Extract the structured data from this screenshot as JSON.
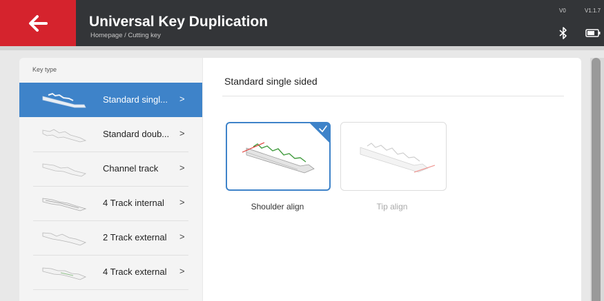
{
  "header": {
    "title": "Universal Key Duplication",
    "breadcrumb": "Homepage / Cutting key",
    "version_v0": "V0",
    "version_v1": "V1.1.7",
    "back_icon": "arrow-left-icon",
    "bluetooth_icon": "bluetooth-icon",
    "battery_icon": "battery-icon"
  },
  "sidebar": {
    "header": "Key type",
    "items": [
      {
        "label": "Standard singl...",
        "chevron": ">",
        "active": true
      },
      {
        "label": "Standard doub...",
        "chevron": ">"
      },
      {
        "label": "Channel track",
        "chevron": ">"
      },
      {
        "label": "4 Track internal",
        "chevron": ">"
      },
      {
        "label": "2 Track external",
        "chevron": ">"
      },
      {
        "label": "4 Track external",
        "chevron": ">"
      }
    ]
  },
  "main": {
    "section_title": "Standard single sided",
    "options": [
      {
        "label": "Shoulder align",
        "selected": true
      },
      {
        "label": "Tip align",
        "selected": false
      }
    ]
  },
  "colors": {
    "header_bg": "#333538",
    "back_button": "#d5232d",
    "accent_blue": "#3e83c9"
  }
}
